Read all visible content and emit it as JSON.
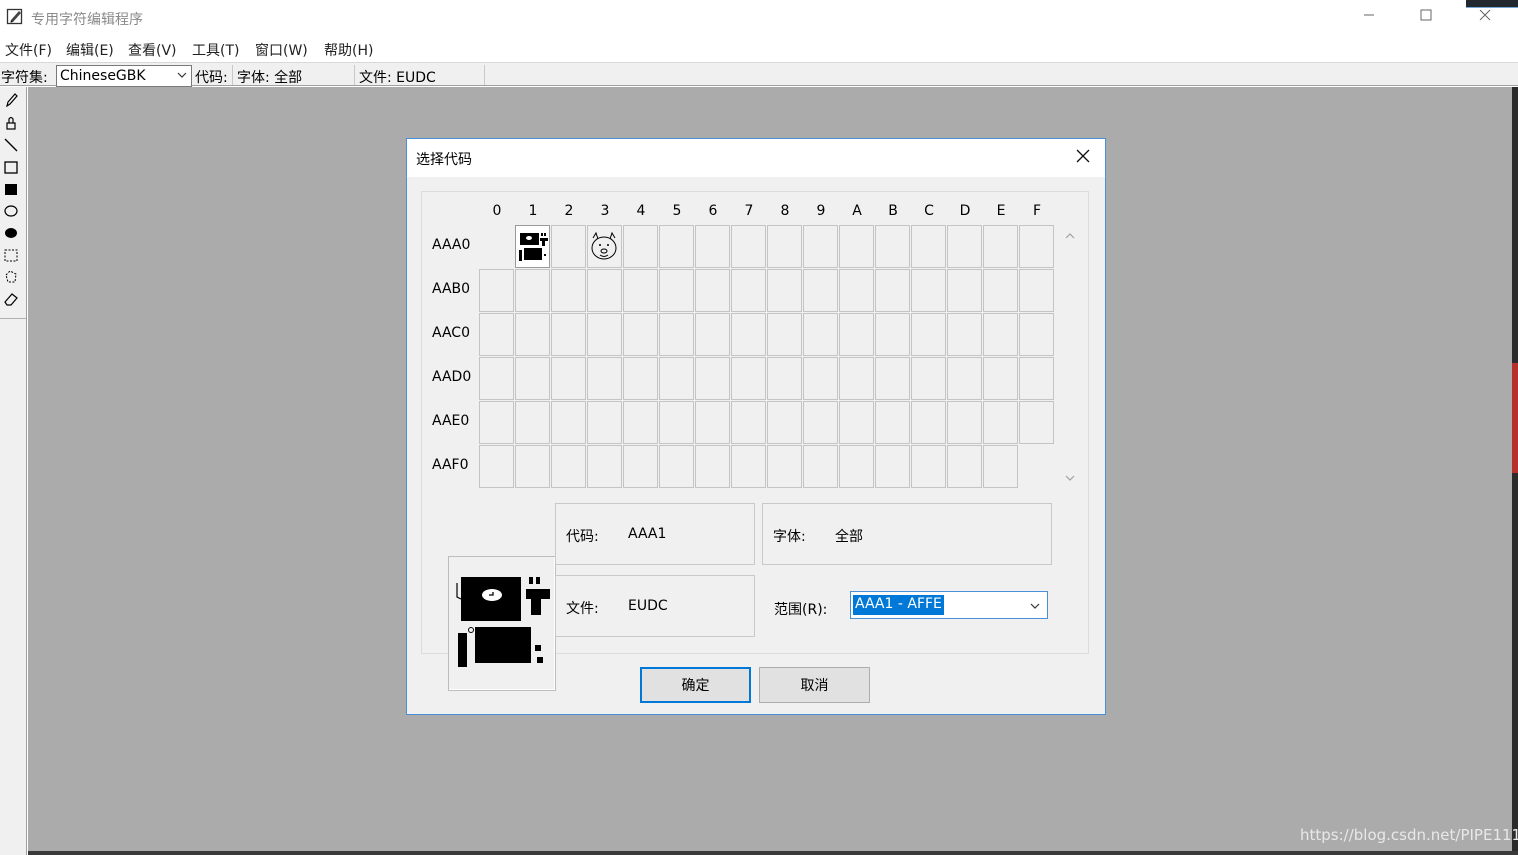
{
  "window": {
    "title": "专用字符编辑程序",
    "app_icon": "edit-pencil-icon",
    "controls": [
      "minimize-icon",
      "maximize-icon",
      "close-icon"
    ]
  },
  "menu": [
    {
      "id": "file",
      "label": "文件(F)"
    },
    {
      "id": "edit",
      "label": "编辑(E)"
    },
    {
      "id": "view",
      "label": "查看(V)"
    },
    {
      "id": "tools",
      "label": "工具(T)"
    },
    {
      "id": "window",
      "label": "窗口(W)"
    },
    {
      "id": "help",
      "label": "帮助(H)"
    }
  ],
  "toolbar": {
    "charset_label": "字符集:",
    "charset_value": "ChineseGBK",
    "code_label": "代码:",
    "font_info": "字体: 全部",
    "file_info": "文件: EUDC"
  },
  "palette": [
    "pencil-icon",
    "brush-icon",
    "line-icon",
    "hollow-rectangle-icon",
    "filled-rectangle-icon",
    "hollow-ellipse-icon",
    "filled-ellipse-icon",
    "rect-select-icon",
    "freeform-select-icon",
    "eraser-icon"
  ],
  "dialog": {
    "title": "选择代码",
    "columns": [
      "0",
      "1",
      "2",
      "3",
      "4",
      "5",
      "6",
      "7",
      "8",
      "9",
      "A",
      "B",
      "C",
      "D",
      "E",
      "F"
    ],
    "rows": [
      "AAA0",
      "AAB0",
      "AAC0",
      "AAD0",
      "AAE0",
      "AAF0"
    ],
    "selected_cell": "AAA1",
    "code_label": "代码:",
    "code_value": "AAA1",
    "font_label": "字体:",
    "font_value": "全部",
    "file_label": "文件:",
    "file_value": "EUDC",
    "range_label": "范围(R):",
    "range_value": "AAA1 - AFFE",
    "ok_label": "确定",
    "cancel_label": "取消"
  },
  "watermark": "https://blog.csdn.net/PIPE111"
}
